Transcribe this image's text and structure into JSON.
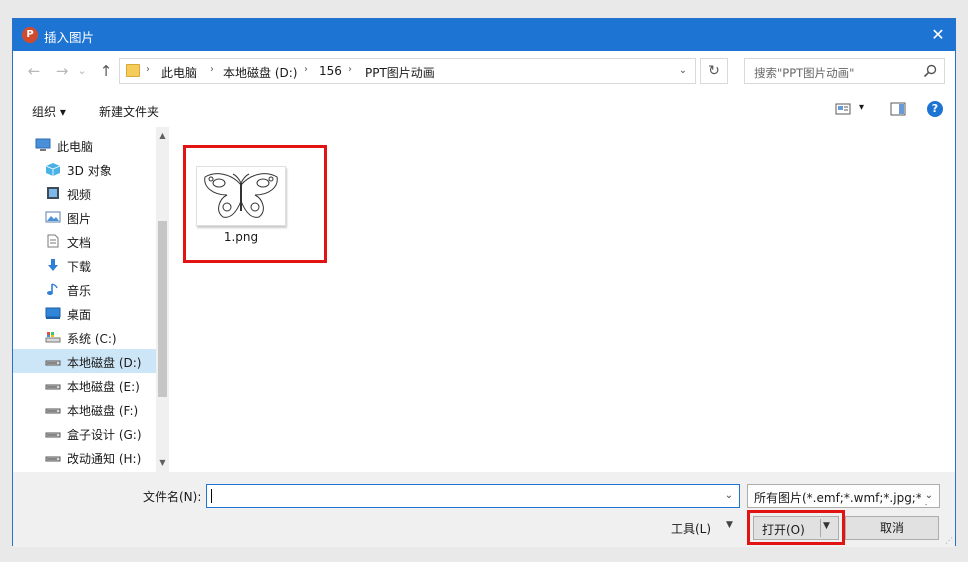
{
  "window": {
    "app_icon_letter": "P",
    "title": "插入图片",
    "close_glyph": "✕"
  },
  "nav": {
    "back_glyph": "←",
    "forward_glyph": "→",
    "recent_glyph": "⌄",
    "up_glyph": "↑",
    "breadcrumb": [
      "此电脑",
      "本地磁盘 (D:)",
      "156",
      "PPT图片动画"
    ],
    "crumb_separator": "›",
    "refresh_glyph": "↻",
    "search_placeholder": "搜索\"PPT图片动画\""
  },
  "toolbar": {
    "organize_label": "组织 ▾",
    "new_folder_label": "新建文件夹",
    "view_dropdown_glyph": "▾",
    "help_glyph": "?"
  },
  "sidebar": {
    "items": [
      {
        "label": "此电脑",
        "icon": "computer-icon"
      },
      {
        "label": "3D 对象",
        "icon": "cube-icon"
      },
      {
        "label": "视频",
        "icon": "video-icon"
      },
      {
        "label": "图片",
        "icon": "picture-icon"
      },
      {
        "label": "文档",
        "icon": "document-icon"
      },
      {
        "label": "下载",
        "icon": "download-icon"
      },
      {
        "label": "音乐",
        "icon": "music-icon"
      },
      {
        "label": "桌面",
        "icon": "desktop-icon"
      },
      {
        "label": "系统 (C:)",
        "icon": "system-drive-icon"
      },
      {
        "label": "本地磁盘 (D:)",
        "icon": "drive-icon",
        "selected": true
      },
      {
        "label": "本地磁盘 (E:)",
        "icon": "drive-icon"
      },
      {
        "label": "本地磁盘 (F:)",
        "icon": "drive-icon"
      },
      {
        "label": "盒子设计 (G:)",
        "icon": "drive-icon"
      },
      {
        "label": "改动通知 (H:)",
        "icon": "drive-icon"
      }
    ],
    "scroll_up_glyph": "▲",
    "scroll_down_glyph": "▼"
  },
  "content": {
    "files": [
      {
        "name": "1.png",
        "thumbnail": "butterfly-thumbnail"
      }
    ]
  },
  "footer": {
    "filename_label": "文件名(N):",
    "filename_value": "",
    "filetype_value": "所有图片(*.emf;*.wmf;*.jpg;*.jfi",
    "dropdown_glyph": "⌄",
    "tools_label": "工具(L)",
    "tools_dropdown_glyph": "▼",
    "open_label": "打开(O)",
    "open_dropdown_glyph": "▼",
    "cancel_label": "取消",
    "grip_glyph": "⋰"
  },
  "colors": {
    "accent": "#1e74d3",
    "highlight": "#e21313",
    "selected_bg": "#cde6f7",
    "folder": "#f5cc58"
  }
}
